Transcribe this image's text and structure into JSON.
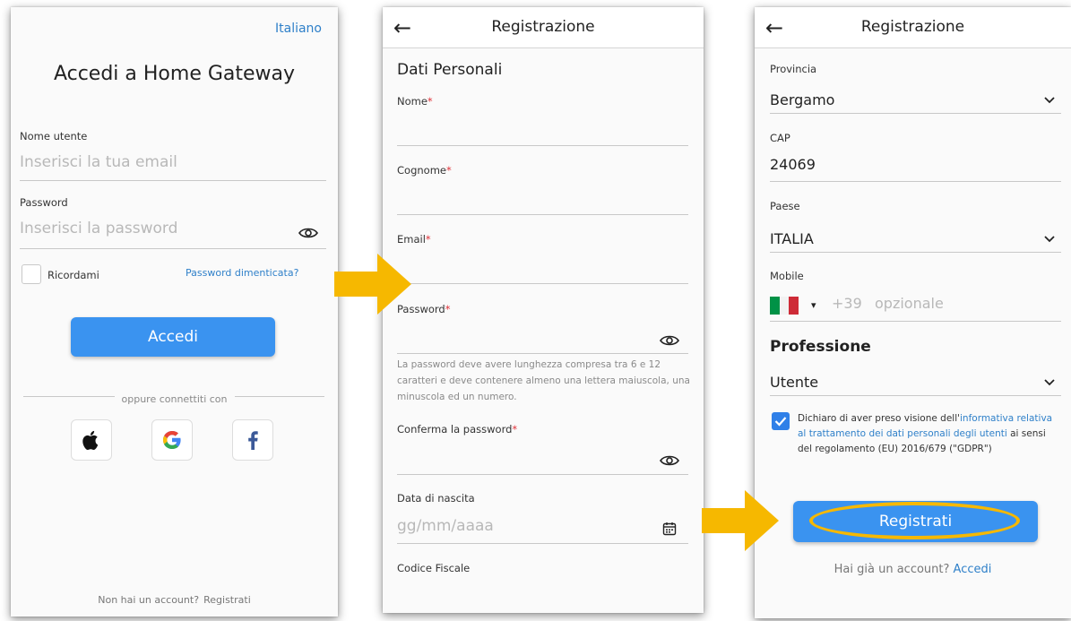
{
  "login": {
    "language": "Italiano",
    "title": "Accedi a Home Gateway",
    "username_label": "Nome utente",
    "username_placeholder": "Inserisci la tua email",
    "password_label": "Password",
    "password_placeholder": "Inserisci la password",
    "remember_label": "Ricordami",
    "forgot_link": "Password dimenticata?",
    "login_button": "Accedi",
    "or_connect": "oppure connettiti con",
    "social": [
      "apple-icon",
      "google-icon",
      "facebook-icon"
    ],
    "no_account": "Non hai un account?",
    "register_link": "Registrati"
  },
  "register1": {
    "title": "Registrazione",
    "section": "Dati Personali",
    "name_label": "Nome",
    "surname_label": "Cognome",
    "email_label": "Email",
    "password_label": "Password",
    "password_hint": "La password deve avere lunghezza compresa tra 6 e 12 caratteri e deve contenere almeno una lettera maiuscola, una minuscola ed un numero.",
    "confirm_label": "Conferma la password",
    "birth_label": "Data di nascita",
    "birth_placeholder": "gg/mm/aaaa",
    "fiscal_label": "Codice Fiscale",
    "required_mark": "*"
  },
  "register2": {
    "title": "Registrazione",
    "province_label": "Provincia",
    "province_value": "Bergamo",
    "cap_label": "CAP",
    "cap_value": "24069",
    "country_label": "Paese",
    "country_value": "ITALIA",
    "mobile_label": "Mobile",
    "phone_prefix": "+39",
    "phone_placeholder": "opzionale",
    "profession_title": "Professione",
    "profession_value": "Utente",
    "gdpr_pre": "Dichiaro di aver preso visione dell'",
    "gdpr_link": "informativa relativa al trattamento dei dati personali degli utenti",
    "gdpr_post": " ai sensi del regolamento (EU) 2016/679 (\"GDPR\")",
    "register_button": "Registrati",
    "have_account": "Hai già un account?",
    "login_link": "Accedi"
  },
  "colors": {
    "accent": "#3a93f0",
    "link": "#2f80c9",
    "required": "#e0323a",
    "arrow": "#f6b800",
    "highlight": "#f6b800"
  }
}
